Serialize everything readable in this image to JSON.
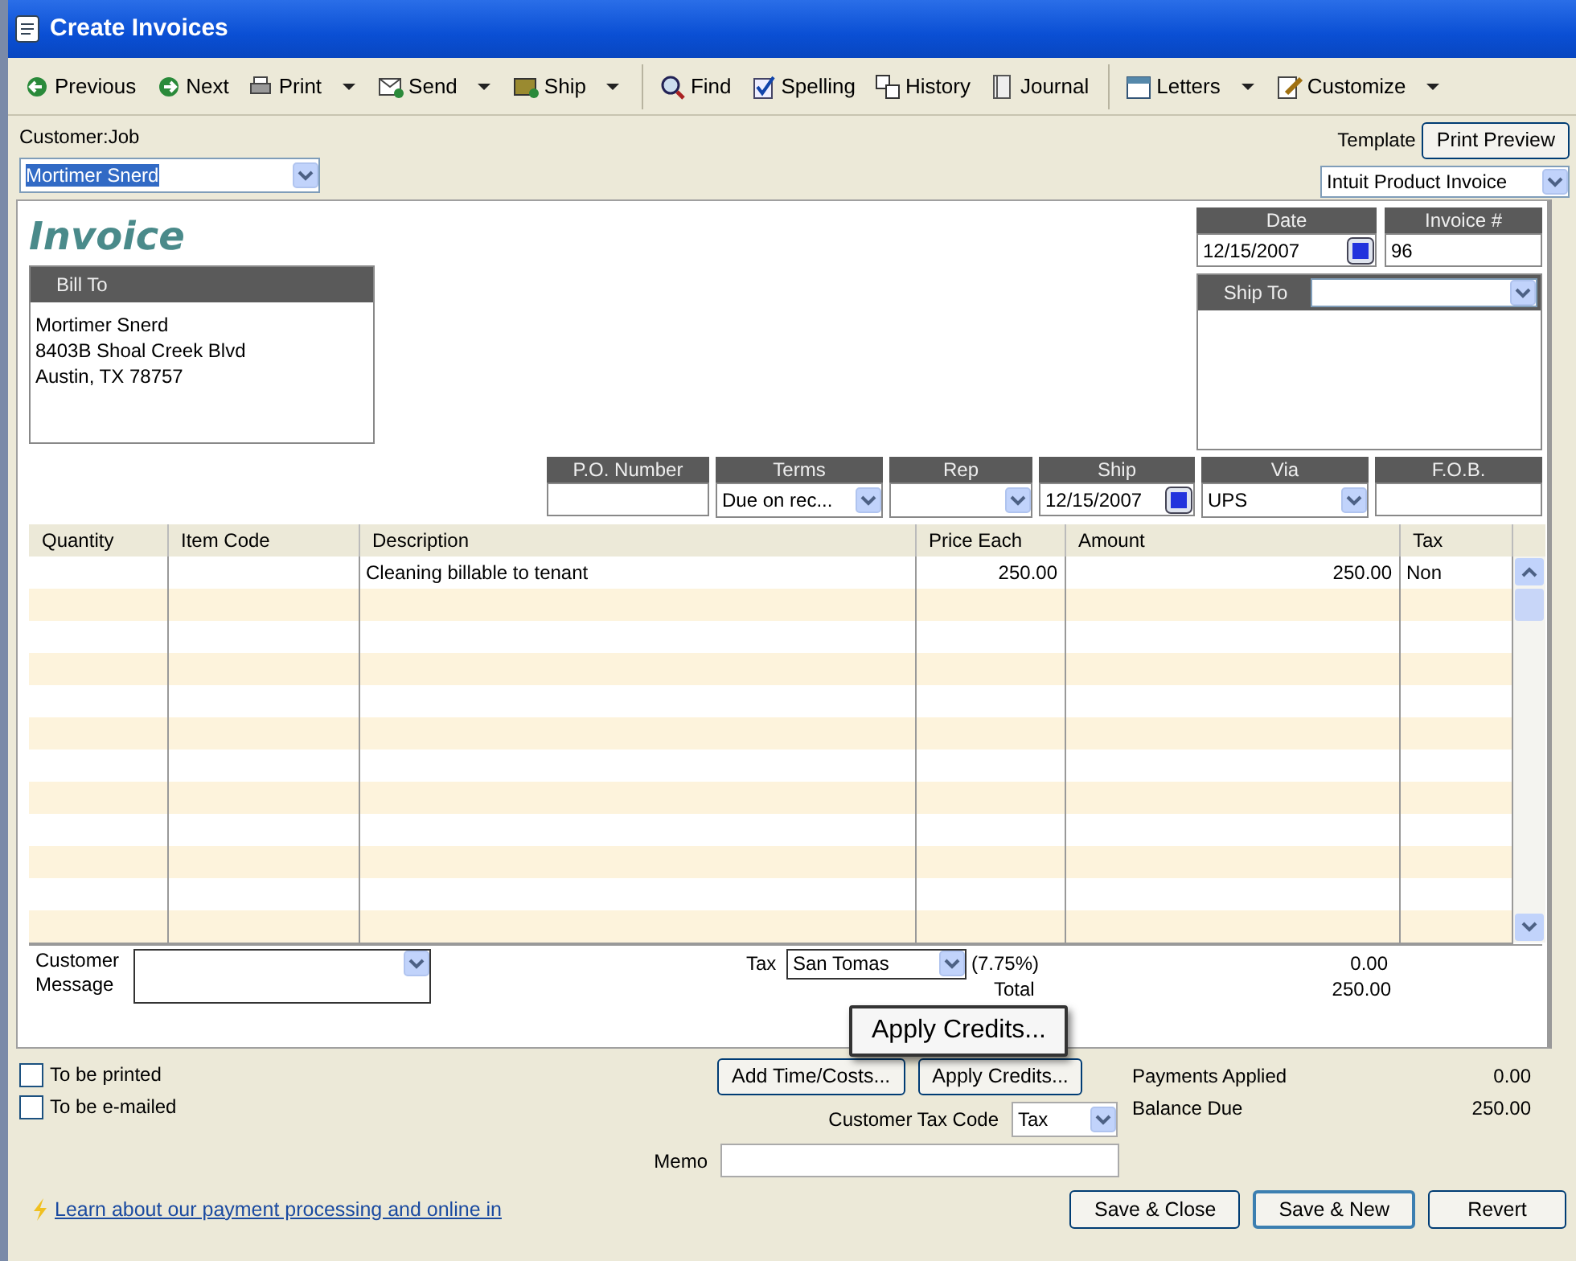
{
  "window": {
    "title": "Create Invoices"
  },
  "toolbar": [
    [
      {
        "label": "Previous",
        "dropdown": false
      },
      {
        "label": "Next",
        "dropdown": false
      },
      {
        "label": "Print",
        "dropdown": true
      },
      {
        "label": "Send",
        "dropdown": true
      },
      {
        "label": "Ship",
        "dropdown": true
      }
    ],
    [
      {
        "label": "Find",
        "dropdown": false
      },
      {
        "label": "Spelling",
        "dropdown": false
      },
      {
        "label": "History",
        "dropdown": false
      },
      {
        "label": "Journal",
        "dropdown": false
      }
    ],
    [
      {
        "label": "Letters",
        "dropdown": true
      },
      {
        "label": "Customize",
        "dropdown": true
      }
    ]
  ],
  "customer_job": {
    "label": "Customer:Job",
    "value": "Mortimer Snerd",
    "selected": true
  },
  "template": {
    "label": "Template",
    "preview_button": "Print Preview",
    "value": "Intuit Product Invoice"
  },
  "invoice": {
    "title": "Invoice",
    "bill_to": {
      "label": "Bill To",
      "lines": [
        "Mortimer Snerd",
        "8403B Shoal Creek Blvd",
        "Austin, TX 78757"
      ]
    },
    "date": {
      "label": "Date",
      "value": "12/15/2007"
    },
    "invoice_number": {
      "label": "Invoice #",
      "value": "96"
    },
    "ship_to": {
      "label": "Ship To"
    }
  },
  "header_fields": [
    {
      "label": "P.O. Number",
      "kind": "text"
    },
    {
      "label": "Terms",
      "value": "Due on rec...",
      "kind": "combo"
    },
    {
      "label": "Rep",
      "kind": "combo"
    },
    {
      "label": "Ship",
      "value": "12/15/2007",
      "kind": "date"
    },
    {
      "label": "Via",
      "value": "UPS",
      "kind": "combo"
    },
    {
      "label": "F.O.B.",
      "kind": "text"
    }
  ],
  "line_items": {
    "columns": [
      "Quantity",
      "Item Code",
      "Description",
      "Price Each",
      "Amount",
      "Tax"
    ],
    "rows": [
      {
        "description": "Cleaning billable to tenant",
        "price_each": "250.00",
        "amount": "250.00",
        "tax": "Non"
      }
    ]
  },
  "customer_message": {
    "label": "Customer Message"
  },
  "tax": {
    "label": "Tax",
    "value": "San Tomas",
    "rate": "(7.75%)",
    "amount": "0.00"
  },
  "total": {
    "label": "Total",
    "amount": "250.00"
  },
  "tooltip": "Apply Credits...",
  "checkboxes": [
    {
      "label": "To be printed",
      "checked": false
    },
    {
      "label": "To be e-mailed",
      "checked": false
    }
  ],
  "middle_buttons": [
    "Add Time/Costs...",
    "Apply Credits..."
  ],
  "summary": [
    {
      "label": "Payments Applied",
      "value": "0.00"
    },
    {
      "label": "Balance Due",
      "value": "250.00"
    }
  ],
  "customer_tax_code": {
    "label": "Customer Tax Code",
    "value": "Tax"
  },
  "memo": {
    "label": "Memo"
  },
  "link": "Learn about our payment processing and online in",
  "actions": [
    {
      "label": "Save & Close",
      "default": false
    },
    {
      "label": "Save & New",
      "default": true
    },
    {
      "label": "Revert",
      "default": false
    }
  ]
}
